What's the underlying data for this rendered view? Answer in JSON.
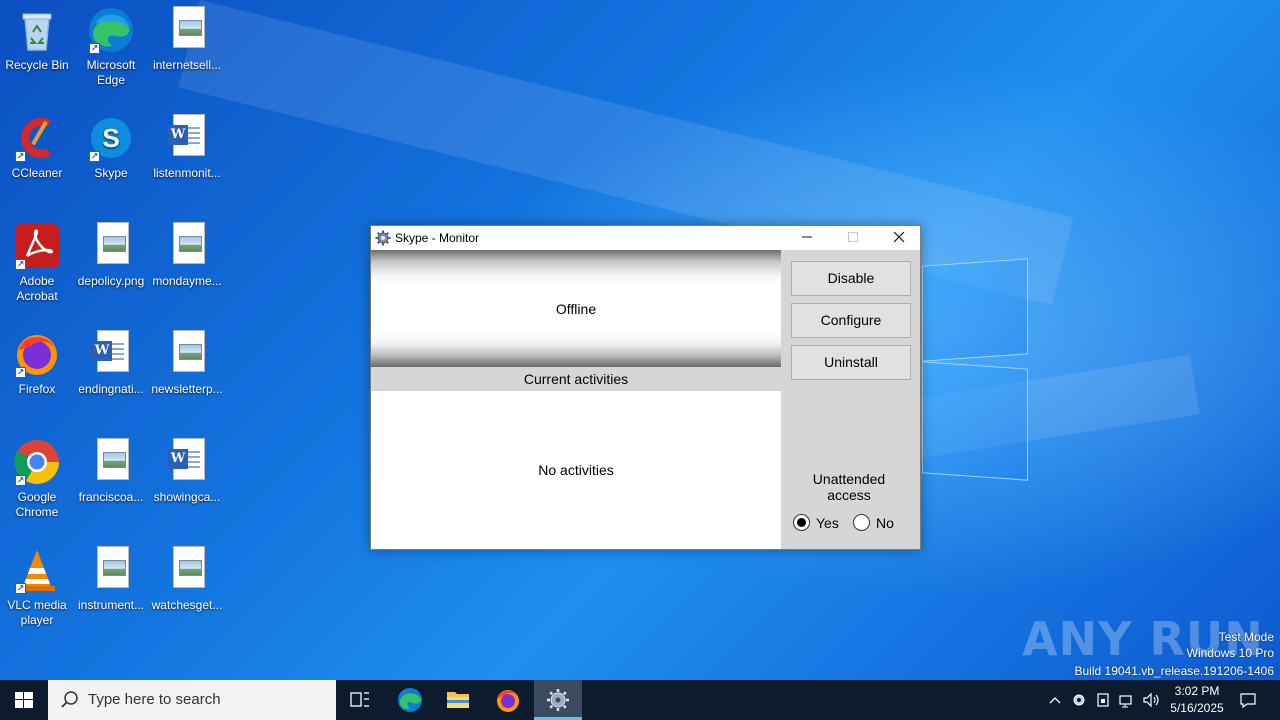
{
  "desktop": {
    "icons": [
      {
        "label": "Recycle Bin"
      },
      {
        "label": "Microsoft Edge"
      },
      {
        "label": "internetsell..."
      },
      {
        "label": "CCleaner"
      },
      {
        "label": "Skype"
      },
      {
        "label": "listenmonit..."
      },
      {
        "label": "Adobe Acrobat"
      },
      {
        "label": "depolicy.png"
      },
      {
        "label": "mondayme..."
      },
      {
        "label": "Firefox"
      },
      {
        "label": "endingnati..."
      },
      {
        "label": "newsletterp..."
      },
      {
        "label": "Google Chrome"
      },
      {
        "label": "franciscoa..."
      },
      {
        "label": "showingca..."
      },
      {
        "label": "VLC media player"
      },
      {
        "label": "instrument..."
      },
      {
        "label": "watchesget..."
      }
    ]
  },
  "dialog": {
    "title": "Skype - Monitor",
    "status": "Offline",
    "activities_header": "Current activities",
    "activities_empty": "No activities",
    "buttons": {
      "disable": "Disable",
      "configure": "Configure",
      "uninstall": "Uninstall"
    },
    "unattended_label": "Unattended access",
    "radio_yes": "Yes",
    "radio_no": "No",
    "unattended_selected": "Yes"
  },
  "watermark": {
    "logo": "ANY RUN",
    "line1": "Test Mode",
    "line2": "Windows 10 Pro",
    "line3": "Build 19041.vb_release.191206-1406"
  },
  "taskbar": {
    "search_placeholder": "Type here to search",
    "time": "3:02 PM",
    "date": "5/16/2025"
  },
  "colors": {
    "desktop_blue": "#1476e0",
    "taskbar": "#0d1b2e"
  }
}
